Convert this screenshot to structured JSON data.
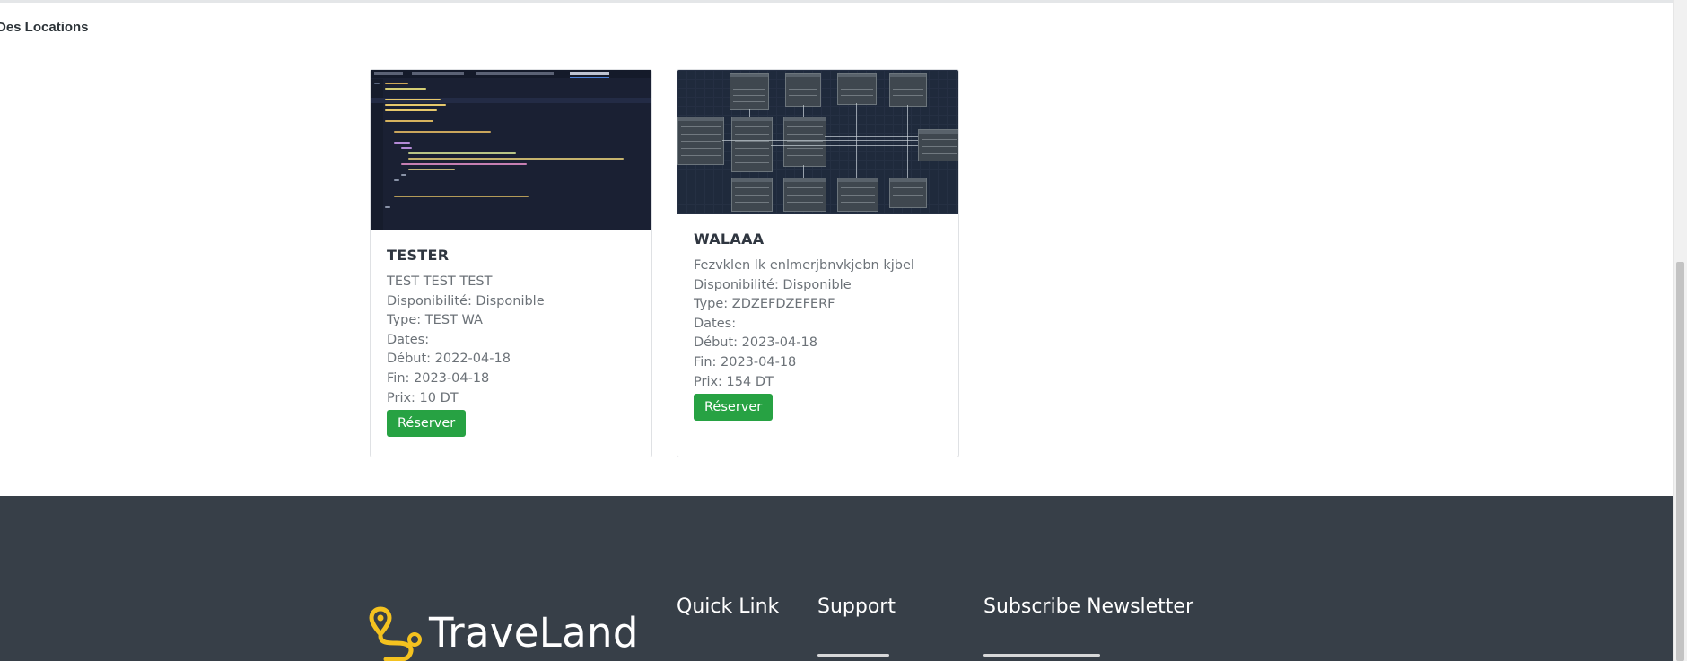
{
  "section": {
    "title": "Des Locations"
  },
  "cards": [
    {
      "title": "TESTER",
      "description": "TEST TEST TEST",
      "availability": "Disponibilité: Disponible",
      "type": "Type: TEST WA",
      "dates_label": "Dates:",
      "start": "Début: 2022-04-18",
      "end": "Fin: 2023-04-18",
      "price": "Prix: 10 DT",
      "button": "Réserver"
    },
    {
      "title": "WALAAA",
      "description": "Fezvklen lk enlmerjbnvkjebn kjbel",
      "availability": "Disponibilité: Disponible",
      "type": "Type: ZDZEFDZEFERF",
      "dates_label": "Dates:",
      "start": "Début: 2023-04-18",
      "end": "Fin: 2023-04-18",
      "price": "Prix: 154 DT",
      "button": "Réserver"
    }
  ],
  "footer": {
    "brand": "TraveLand",
    "headings": {
      "quick_link": "Quick Link",
      "support": "Support",
      "newsletter": "Subscribe Newsletter"
    }
  },
  "colors": {
    "button": "#27a243",
    "footer_bg": "#373f48",
    "logo_accent": "#f4c21f"
  }
}
